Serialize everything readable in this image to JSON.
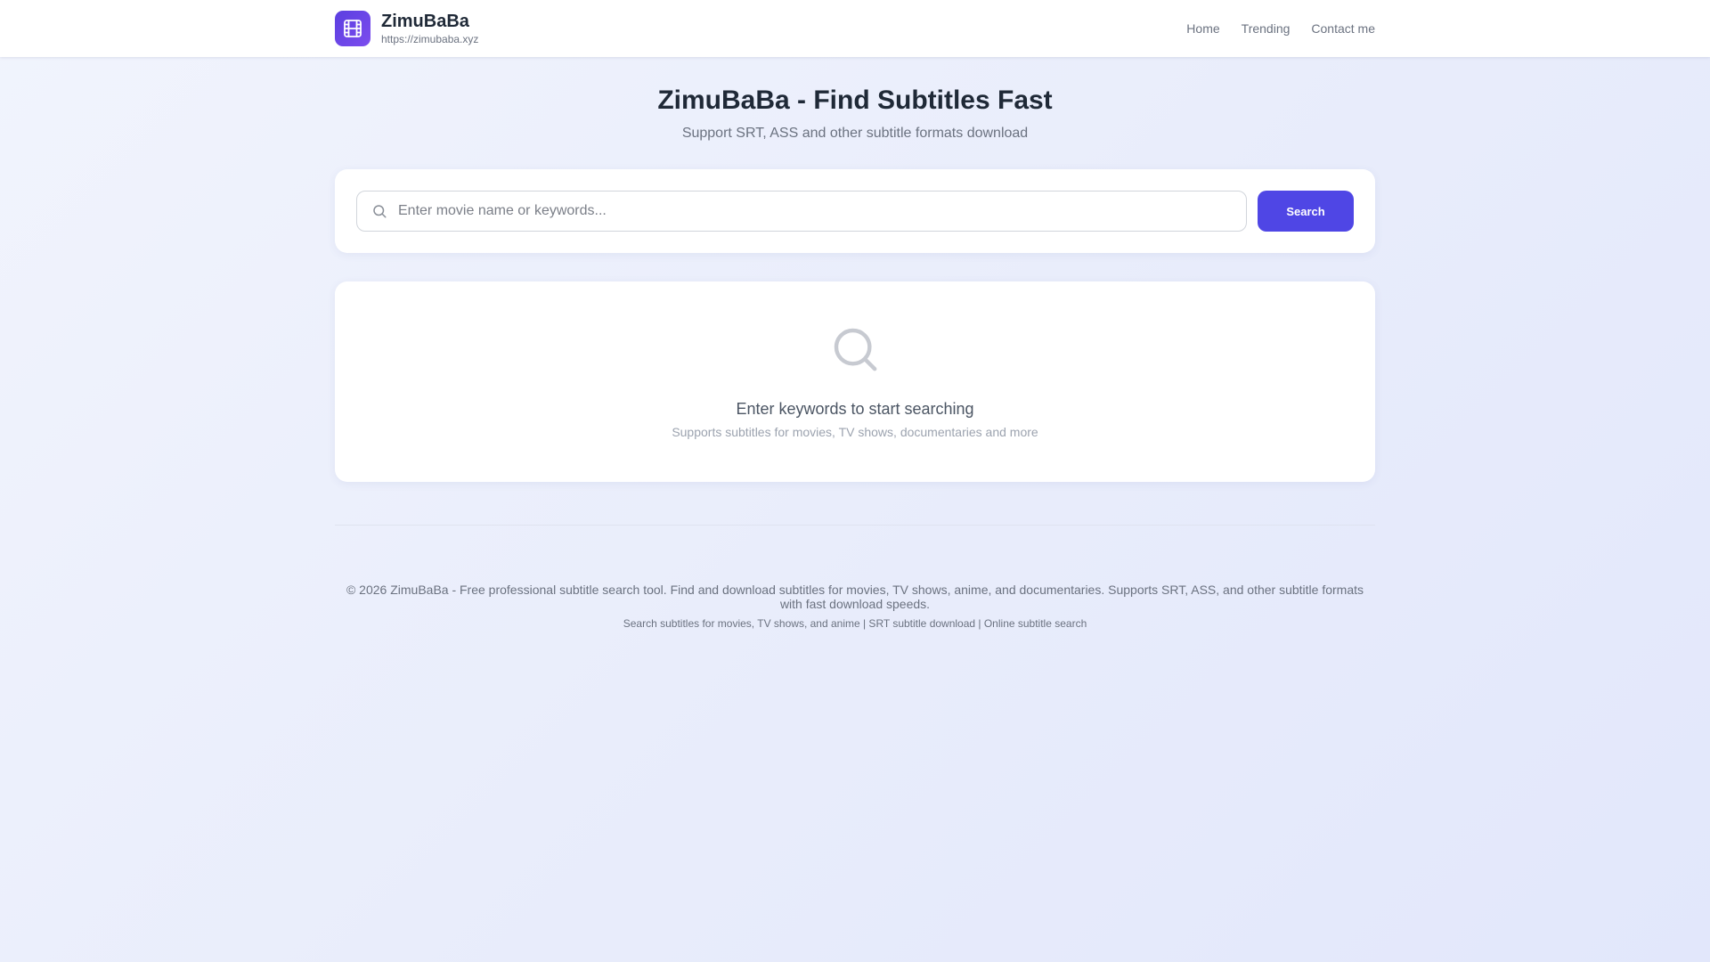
{
  "header": {
    "brand_name": "ZimuBaBa",
    "brand_url": "https://zimubaba.xyz",
    "logo_icon": "film-icon",
    "nav": [
      "Home",
      "Trending",
      "Contact me"
    ]
  },
  "hero": {
    "title": "ZimuBaBa - Find Subtitles Fast",
    "subtitle": "Support SRT, ASS and other subtitle formats download"
  },
  "search": {
    "placeholder": "Enter movie name or keywords...",
    "value": "",
    "button_label": "Search",
    "icon": "search-icon"
  },
  "empty_state": {
    "icon": "search-icon",
    "title": "Enter keywords to start searching",
    "subtitle": "Supports subtitles for movies, TV shows, documentaries and more"
  },
  "footer": {
    "copyright": "© 2026 ZimuBaBa - Free professional subtitle search tool. Find and download subtitles for movies, TV shows, anime, and documentaries. Supports SRT, ASS, and other subtitle formats with fast download speeds.",
    "keywords": "Search subtitles for movies, TV shows, and anime | SRT subtitle download | Online subtitle search"
  },
  "colors": {
    "accent": "#4f46e5",
    "logo_gradient_start": "#5b3fe0",
    "logo_gradient_end": "#7c4dee",
    "background": "#eaeefb",
    "card": "#ffffff",
    "text_primary": "#1f2937",
    "text_secondary": "#6b7280"
  }
}
